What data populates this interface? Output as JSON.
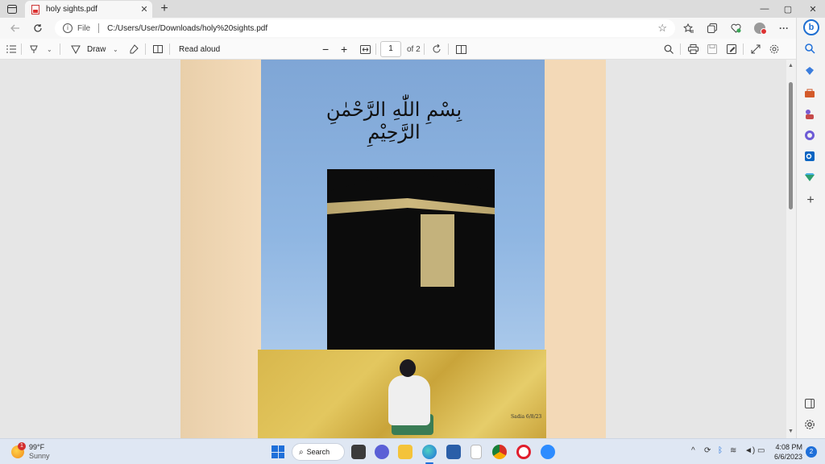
{
  "browser": {
    "tab": {
      "title": "holy sights.pdf",
      "close": "✕"
    },
    "new_tab": "+",
    "window_controls": {
      "minimize": "—",
      "maximize": "▢",
      "close": "✕"
    },
    "address": {
      "scheme": "File",
      "url": "C:/Users/User/Downloads/holy%20sights.pdf"
    },
    "toolbar_icons": [
      "favorites-icon",
      "collections-icon",
      "extensions-icon",
      "profile-icon",
      "more-icon"
    ],
    "more": "···"
  },
  "pdf_toolbar": {
    "draw_label": "Draw",
    "read_aloud_label": "Read aloud",
    "zoom_out": "−",
    "zoom_in": "+",
    "page_current": "1",
    "page_total": "of 2"
  },
  "document": {
    "calligraphy": "بِسْمِ اللّٰهِ الرَّحْمٰنِ الرَّحِيْمِ",
    "signature": "Sadia 6/8/23"
  },
  "taskbar": {
    "weather": {
      "temp": "99°F",
      "condition": "Sunny",
      "badge": "1"
    },
    "search_label": "Search",
    "clock": {
      "time": "4:08 PM",
      "date": "6/6/2023"
    },
    "notification_count": "2"
  },
  "colors": {
    "accent": "#1e6fd9",
    "sky": "#8fb6e2",
    "kaaba": "#0c0c0c",
    "gold": "#c4b27c"
  }
}
